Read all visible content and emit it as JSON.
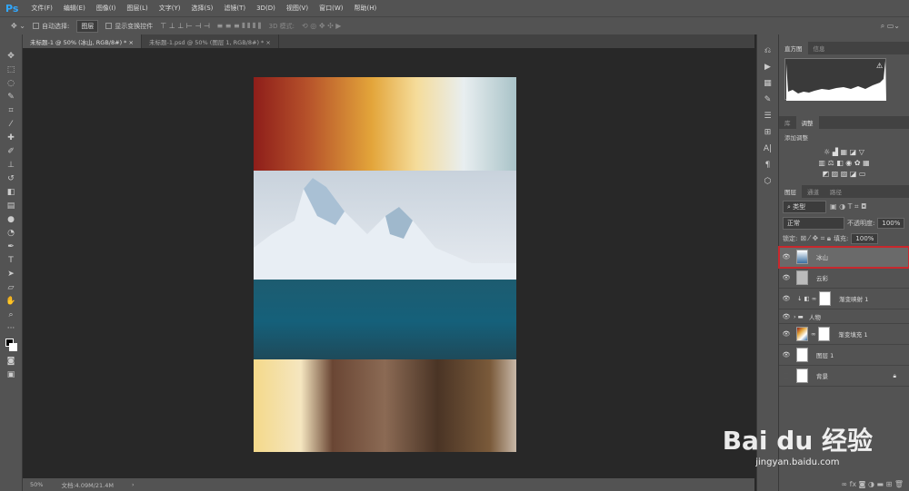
{
  "app": {
    "logo": "Ps"
  },
  "menu": [
    "文件(F)",
    "编辑(E)",
    "图像(I)",
    "图层(L)",
    "文字(Y)",
    "选择(S)",
    "滤镜(T)",
    "3D(D)",
    "视图(V)",
    "窗口(W)",
    "帮助(H)"
  ],
  "options": {
    "auto_select_label": "自动选择:",
    "auto_select_value": "图层",
    "show_transform": "显示变换控件",
    "mode3d": "3D 模式:"
  },
  "tabs": [
    "未标题-1 @ 50% (冰山, RGB/8#) *",
    "未标题-1.psd @ 50% (图层 1, RGB/8#) *"
  ],
  "status": {
    "zoom": "50%",
    "doc": "文档:4.09M/21.4M"
  },
  "panels": {
    "histogram_tabs": [
      "直方图",
      "信息"
    ],
    "adjust_tabs": [
      "库",
      "调整"
    ],
    "adjust_title": "添加调整",
    "layers_tabs": [
      "图层",
      "通道",
      "路径"
    ],
    "filter_kind": "类型",
    "blend_mode": "正常",
    "opacity_label": "不透明度:",
    "opacity": "100%",
    "lock_label": "锁定:",
    "fill_label": "填充:",
    "fill": "100%"
  },
  "layers": [
    {
      "name": "冰山",
      "visible": true,
      "selected": true
    },
    {
      "name": "云彩",
      "visible": true
    },
    {
      "name": "渐变映射 1",
      "visible": true
    },
    {
      "name": "人物",
      "visible": true,
      "group": true
    },
    {
      "name": "渐变填充 1",
      "visible": true
    },
    {
      "name": "图层 1",
      "visible": true
    },
    {
      "name": "背景",
      "visible": false,
      "locked": true
    }
  ],
  "watermark": {
    "brand": "Bai du 经验",
    "url": "jingyan.baidu.com"
  }
}
